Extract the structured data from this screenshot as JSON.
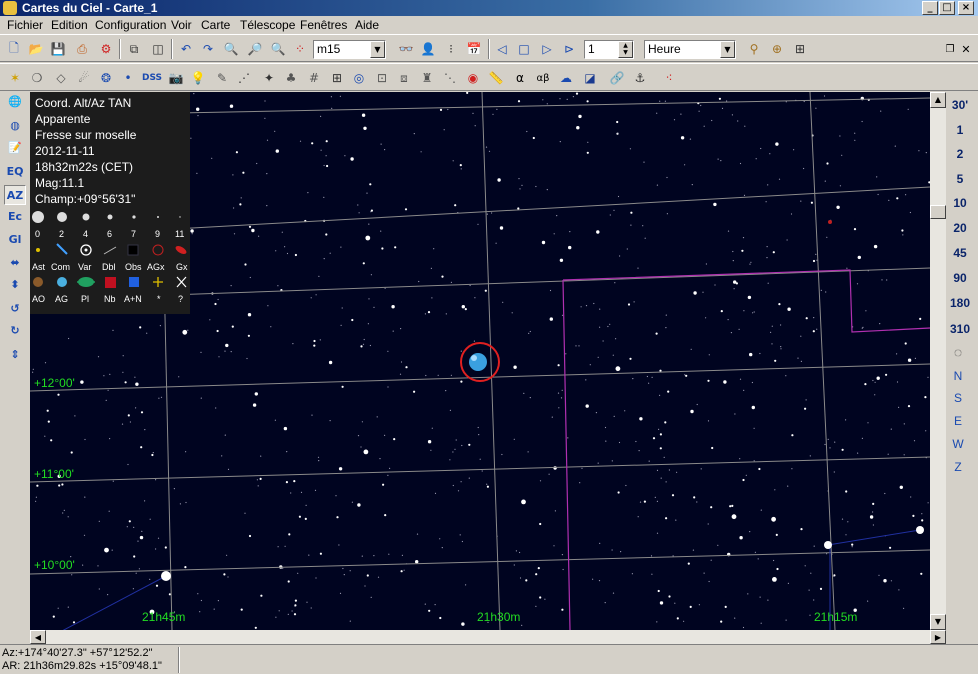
{
  "window": {
    "title": "Cartes du Ciel - Carte_1"
  },
  "menu": [
    "Fichier",
    "Edition",
    "Configuration",
    "Voir",
    "Carte",
    "Télescope",
    "Fenêtres",
    "Aide"
  ],
  "toolbar": {
    "search_value": "m15",
    "step_value": "1",
    "time_unit": "Heure"
  },
  "left_toolbar": [
    "EQ",
    "AZ",
    "Ec",
    "Gl"
  ],
  "info_panel": {
    "projection": "Coord. Alt/Az TAN",
    "mode": "Apparente",
    "location": "Fresse sur moselle",
    "date": "2012-11-11",
    "time": "18h32m22s (CET)",
    "magnitude": "Mag:11.1",
    "field": "Champ:+09°56'31\"",
    "mag_scale": [
      "0",
      "2",
      "4",
      "6",
      "7",
      "9",
      "11"
    ],
    "legend_row1": [
      "Ast",
      "Com",
      "Var",
      "Dbl",
      "Obs",
      "AGx",
      "Gx"
    ],
    "legend_row2": [
      "AO",
      "AG",
      "Pl",
      "Nb",
      "A+N",
      "*",
      "?"
    ]
  },
  "map": {
    "dec_labels": [
      "+12°00'",
      "+11°00'",
      "+10°00'"
    ],
    "ra_labels": [
      "21h45m",
      "21h30m",
      "21h15m"
    ]
  },
  "right_panel": {
    "fov": [
      "30'",
      "1",
      "2",
      "5",
      "10",
      "20",
      "45",
      "90",
      "180",
      "310"
    ],
    "directions": [
      "N",
      "S",
      "E",
      "W",
      "Z"
    ]
  },
  "status": {
    "az_line": "Az:+174°40'27.3\" +57°12'52.2\"",
    "ar_line": "AR: 21h36m29.82s +15°09'48.1\""
  },
  "colors": {
    "sky": "#000420",
    "grid": "#8a8a8a",
    "grid_label": "#22dd22",
    "constellation_boundary": "#b030b0",
    "object_marker": "#e02020",
    "planet": "#3aa0e0"
  }
}
